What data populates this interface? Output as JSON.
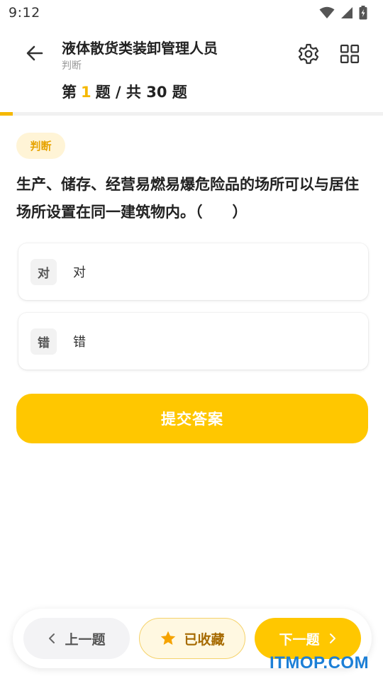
{
  "status_bar": {
    "time": "9:12"
  },
  "header": {
    "title": "液体散货类装卸管理人员",
    "subtitle": "判断",
    "progress": {
      "prefix": "第",
      "current": "1",
      "middle": "题 / 共",
      "total": "30",
      "suffix": "题"
    },
    "progress_fraction": 0.0333
  },
  "question": {
    "type_badge": "判断",
    "text": "生产、储存、经营易燃易爆危险品的场所可以与居住场所设置在同一建筑物内。（　　）",
    "options": [
      {
        "key": "对",
        "text": "对"
      },
      {
        "key": "错",
        "text": "错"
      }
    ],
    "submit_label": "提交答案"
  },
  "bottom_bar": {
    "prev_label": "上一题",
    "favorite_label": "已收藏",
    "next_label": "下一题"
  },
  "watermark": "ITMOP.COM",
  "colors": {
    "accent": "#ffc700",
    "accent_text": "#f5b800",
    "badge_bg": "#fff4d6"
  }
}
